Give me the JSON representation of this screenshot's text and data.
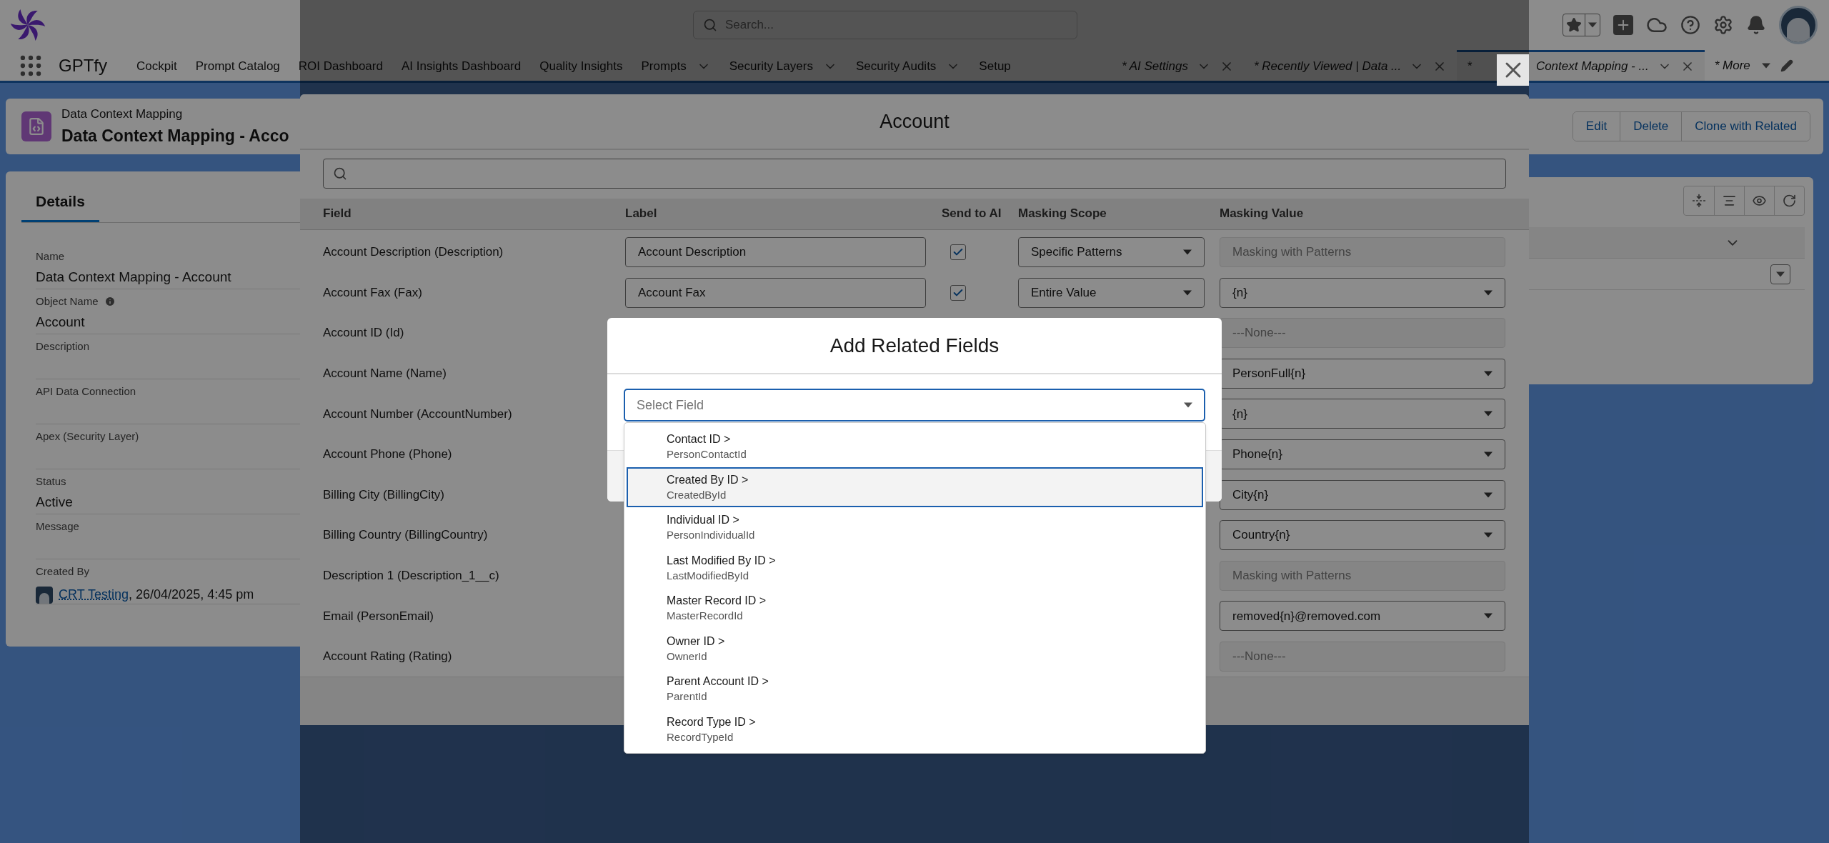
{
  "global_header": {
    "search": {
      "placeholder": "Search..."
    }
  },
  "nav": {
    "app_name": "GPTfy",
    "tabs": [
      {
        "label": "Cockpit",
        "kind": "plain",
        "selected": false
      },
      {
        "label": "Prompt Catalog",
        "kind": "plain",
        "selected": false
      },
      {
        "label": "ROI Dashboard",
        "kind": "plain",
        "selected": false
      },
      {
        "label": "AI Insights Dashboard",
        "kind": "plain",
        "selected": false
      },
      {
        "label": "Quality Insights",
        "kind": "plain",
        "selected": false
      },
      {
        "label": "Prompts",
        "kind": "menu",
        "selected": false
      },
      {
        "label": "Security Layers",
        "kind": "menu",
        "selected": false
      },
      {
        "label": "Security Audits",
        "kind": "menu",
        "selected": false
      },
      {
        "label": "Setup",
        "kind": "plain",
        "selected": false
      },
      {
        "label": "* AI Settings",
        "kind": "workspace",
        "selected": false
      },
      {
        "label": "* Recently Viewed | Data ...",
        "kind": "workspace",
        "selected": false
      },
      {
        "prefix": "*",
        "label": "Context Mapping - ...",
        "kind": "workspace",
        "selected": true
      }
    ],
    "more": "* More"
  },
  "record": {
    "type": "Data Context Mapping",
    "title": "Data Context Mapping - Acco",
    "actions": [
      "Edit",
      "Delete",
      "Clone with Related"
    ]
  },
  "details": {
    "tab": "Details",
    "fields": [
      {
        "label": "Name",
        "info": false,
        "value": "Data Context Mapping - Account"
      },
      {
        "label": "Object Name",
        "info": true,
        "value": "Account"
      },
      {
        "label": "Description",
        "info": false
      },
      {
        "label": "API Data Connection",
        "info": false
      },
      {
        "label": "Apex (Security Layer)",
        "info": false
      },
      {
        "label": "Status",
        "info": false,
        "value": "Active"
      },
      {
        "label": "Message",
        "info": false
      },
      {
        "label": "Created By",
        "info": false,
        "link": "CRT Testing",
        "value": ", 26/04/2025, 4:45 pm"
      }
    ]
  },
  "account_modal": {
    "title": "Account",
    "columns": [
      "Field",
      "Label",
      "Send to AI",
      "Masking Scope",
      "Masking Value"
    ],
    "rows": [
      {
        "field": "Account Description (Description)",
        "label": "Account Description",
        "send_to_ai": true,
        "scope": "Specific Patterns",
        "masking": {
          "kind": "disabled",
          "value": "Masking with Patterns"
        }
      },
      {
        "field": "Account Fax (Fax)",
        "label": "Account Fax",
        "send_to_ai": true,
        "scope": "Entire Value",
        "masking": {
          "kind": "select",
          "value": "{n}"
        }
      },
      {
        "field": "Account ID (Id)",
        "masking": {
          "kind": "disabled",
          "value": "---None---"
        }
      },
      {
        "field": "Account Name (Name)",
        "masking": {
          "kind": "select",
          "value": "PersonFull{n}"
        }
      },
      {
        "field": "Account Number (AccountNumber)",
        "masking": {
          "kind": "select",
          "value": "{n}"
        }
      },
      {
        "field": "Account Phone (Phone)",
        "masking": {
          "kind": "select",
          "value": "Phone{n}"
        }
      },
      {
        "field": "Billing City (BillingCity)",
        "masking": {
          "kind": "select",
          "value": "City{n}"
        }
      },
      {
        "field": "Billing Country (BillingCountry)",
        "masking": {
          "kind": "select",
          "value": "Country{n}"
        }
      },
      {
        "field": "Description 1 (Description_1__c)",
        "masking": {
          "kind": "disabled",
          "value": "Masking with Patterns"
        }
      },
      {
        "field": "Email (PersonEmail)",
        "masking": {
          "kind": "select",
          "value": "removed{n}@removed.com"
        }
      },
      {
        "field": "Account Rating (Rating)",
        "masking": {
          "kind": "disabled",
          "value": "---None---"
        }
      }
    ]
  },
  "related_modal": {
    "title": "Add Related Fields",
    "select": {
      "placeholder": "Select Field"
    },
    "options": [
      {
        "label": "Contact ID >",
        "api_name": "PersonContactId",
        "selected": false
      },
      {
        "label": "Created By ID >",
        "api_name": "CreatedById",
        "selected": true
      },
      {
        "label": "Individual ID >",
        "api_name": "PersonIndividualId",
        "selected": false
      },
      {
        "label": "Last Modified By ID >",
        "api_name": "LastModifiedById",
        "selected": false
      },
      {
        "label": "Master Record ID >",
        "api_name": "MasterRecordId",
        "selected": false
      },
      {
        "label": "Owner ID >",
        "api_name": "OwnerId",
        "selected": false
      },
      {
        "label": "Parent Account ID >",
        "api_name": "ParentId",
        "selected": false
      },
      {
        "label": "Record Type ID >",
        "api_name": "RecordTypeId",
        "selected": false
      }
    ]
  }
}
